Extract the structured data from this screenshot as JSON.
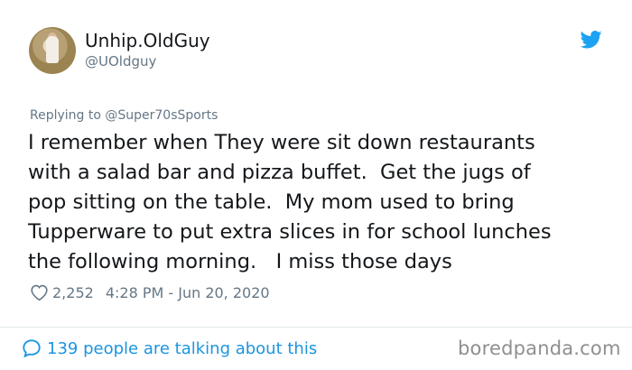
{
  "author": {
    "name": "Unhip.OldGuy",
    "handle": "@UOldguy"
  },
  "reply": {
    "text": "Replying to @Super70sSports"
  },
  "tweet": {
    "text": "I remember when They were sit down restaurants\nwith a salad bar and pizza buffet.  Get the jugs of\npop sitting on the table.  My mom used to bring\nTupperware to put extra slices in for school lunches\nthe following morning.   I miss those days"
  },
  "meta": {
    "likes": "2,252",
    "timestamp": "4:28 PM - Jun 20, 2020"
  },
  "footer": {
    "talking": "139 people are talking about this",
    "brand": "boredpanda.com"
  },
  "icons": {
    "twitter": "twitter-bird-icon",
    "heart": "heart-icon",
    "comment": "comment-bubble-icon"
  },
  "colors": {
    "twitter_blue": "#1da1f2",
    "link_blue": "#1b95e0",
    "muted_gray": "#657786",
    "text_dark": "#14171a"
  }
}
